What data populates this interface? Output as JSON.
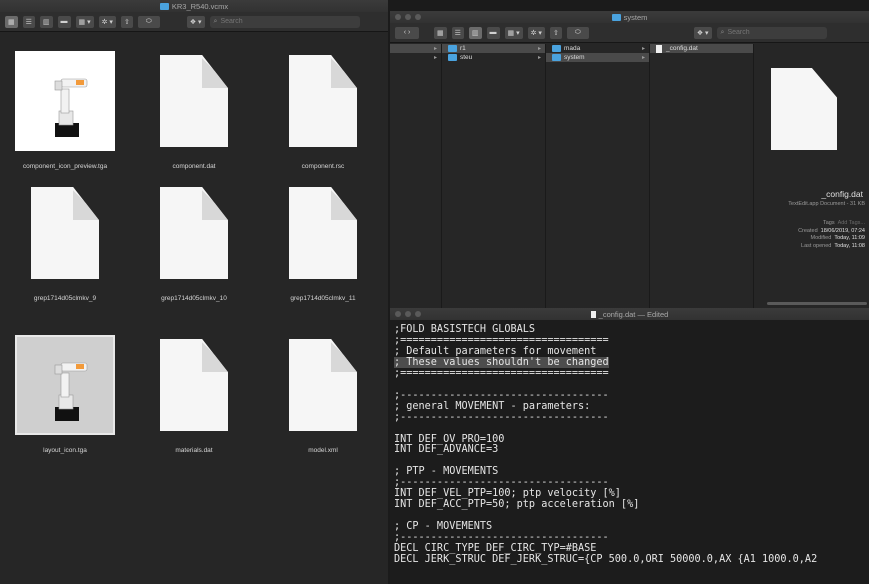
{
  "left_window": {
    "title": "KR3_R540.vcmx",
    "search_placeholder": "Search",
    "files": [
      {
        "name": "component_icon_preview.tga",
        "kind": "photo-white"
      },
      {
        "name": "component.dat",
        "kind": "doc"
      },
      {
        "name": "component.rsc",
        "kind": "doc"
      },
      {
        "name": "grep1714d05clmkv_9",
        "kind": "doc"
      },
      {
        "name": "grep1714d05clmkv_10",
        "kind": "doc"
      },
      {
        "name": "grep1714d05clmkv_11",
        "kind": "doc"
      },
      {
        "name": "layout_icon.tga",
        "kind": "photo-grey"
      },
      {
        "name": "materials.dat",
        "kind": "doc"
      },
      {
        "name": "model.xml",
        "kind": "doc"
      }
    ]
  },
  "right_window": {
    "title": "system",
    "search_placeholder": "Search",
    "columns": [
      {
        "items": [
          {
            "label": "",
            "selected": true,
            "has_arrow": true
          },
          {
            "label": "",
            "selected": false,
            "has_arrow": true
          }
        ]
      },
      {
        "items": [
          {
            "label": "r1",
            "selected": true,
            "has_arrow": true
          },
          {
            "label": "steu",
            "selected": false,
            "has_arrow": true
          }
        ]
      },
      {
        "items": [
          {
            "label": "mada",
            "selected": false,
            "has_arrow": true
          },
          {
            "label": "system",
            "selected": true,
            "has_arrow": true
          }
        ]
      },
      {
        "items": [
          {
            "label": "_config.dat",
            "selected": true,
            "has_arrow": false
          }
        ]
      }
    ],
    "preview": {
      "name": "_config.dat",
      "kind": "TextEdit.app Document - 31 KB",
      "tags_label": "Tags",
      "tags_placeholder": "Add Tags...",
      "created_label": "Created",
      "created_value": "18/06/2019, 07:24",
      "modified_label": "Modified",
      "modified_value": "Today, 11:09",
      "opened_label": "Last opened",
      "opened_value": "Today, 11:08"
    }
  },
  "editor_window": {
    "title": "_config.dat — Edited",
    "lines": [
      ";FOLD BASISTECH GLOBALS",
      ";==================================",
      "; Default parameters for movement",
      "; These values shouldn't be changed",
      ";==================================",
      "",
      ";----------------------------------",
      "; general MOVEMENT - parameters:",
      ";----------------------------------",
      "",
      "INT DEF_OV_PRO=100",
      "INT DEF_ADVANCE=3",
      "",
      "; PTP - MOVEMENTS",
      ";----------------------------------",
      "INT DEF_VEL_PTP=100; ptp velocity [%]",
      "INT DEF_ACC_PTP=50; ptp acceleration [%]",
      "",
      "; CP - MOVEMENTS",
      ";----------------------------------",
      "DECL CIRC_TYPE DEF_CIRC_TYP=#BASE",
      "DECL JERK_STRUC DEF_JERK_STRUC={CP 500.0,ORI 50000.0,AX {A1 1000.0,A2"
    ],
    "highlighted_line": 3
  },
  "colors": {
    "folder": "#4aa3df",
    "window_bg": "#262626",
    "editor_bg": "#1c1c1c"
  }
}
